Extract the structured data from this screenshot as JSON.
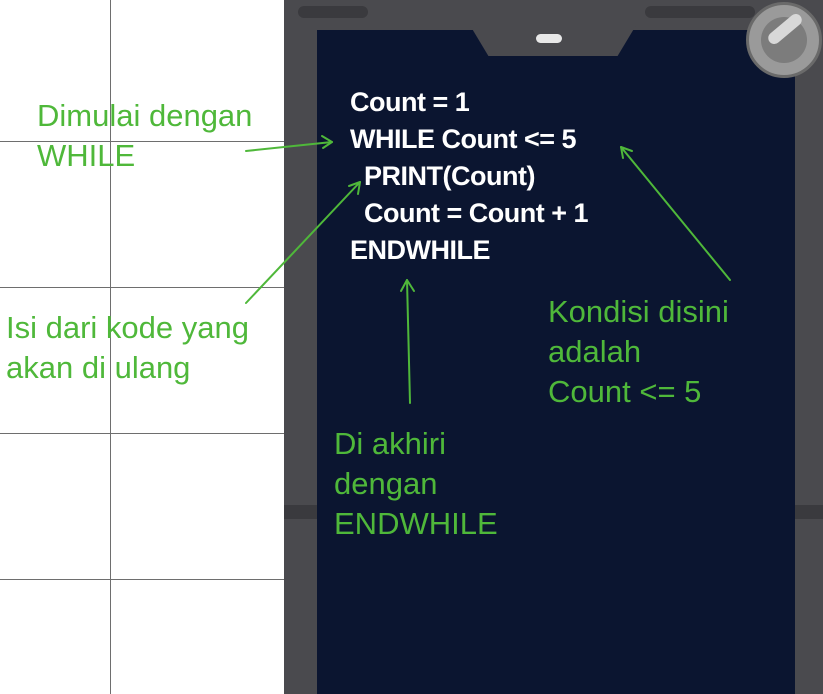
{
  "code_lines": [
    "Count = 1",
    "WHILE Count <= 5",
    "  PRINT(Count)",
    "  Count = Count + 1",
    "ENDWHILE"
  ],
  "annotations": {
    "while_start": {
      "lines": [
        "Dimulai dengan",
        "WHILE"
      ]
    },
    "loop_body": {
      "lines": [
        "Isi dari kode yang",
        "akan di ulang"
      ]
    },
    "condition": {
      "lines": [
        "Kondisi disini",
        "adalah",
        "Count <= 5"
      ]
    },
    "end_while": {
      "lines": [
        "Di akhiri",
        "dengan",
        "ENDWHILE"
      ]
    }
  },
  "colors": {
    "annotation": "#4fb83a",
    "screen": "#0b1530",
    "frame": "#4a4a4e",
    "code_text": "#ffffff"
  },
  "icons": [
    "camera-icon",
    "arrow-icon"
  ]
}
